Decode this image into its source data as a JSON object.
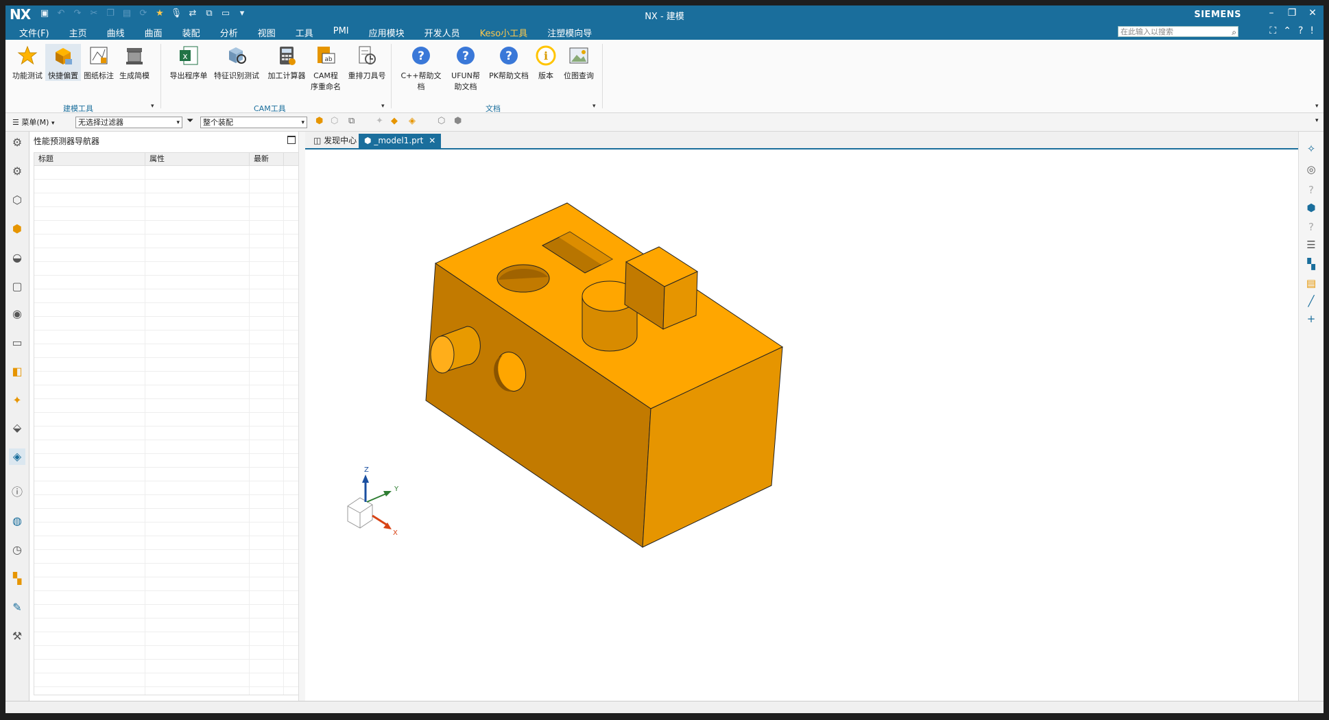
{
  "app": {
    "logo": "NX",
    "title": "NX - 建模",
    "brand": "SIEMENS"
  },
  "menu": {
    "items": [
      "文件(F)",
      "主页",
      "曲线",
      "曲面",
      "装配",
      "分析",
      "视图",
      "工具",
      "PMI",
      "应用模块",
      "开发人员",
      "Keso小工具",
      "注塑模向导"
    ],
    "active": "Keso小工具",
    "search_placeholder": "在此输入以搜索"
  },
  "ribbon": {
    "buttons": [
      {
        "label": "功能测试",
        "icon": "star-icon"
      },
      {
        "label": "快捷偏置",
        "icon": "offset-block-icon"
      },
      {
        "label": "图纸标注",
        "icon": "drawing-annotation-icon"
      },
      {
        "label": "生成简模",
        "icon": "simple-model-icon"
      },
      {
        "label": "导出程序单",
        "icon": "excel-icon"
      },
      {
        "label": "特征识别测试",
        "icon": "feature-recognition-icon"
      },
      {
        "label": "加工计算器",
        "icon": "calculator-icon"
      },
      {
        "label": "CAM程序重命名",
        "icon": "cam-rename-icon"
      },
      {
        "label": "重排刀具号",
        "icon": "tool-renumber-icon"
      },
      {
        "label": "C++帮助文档",
        "icon": "help-icon"
      },
      {
        "label": "UFUN帮助文档",
        "icon": "help-icon"
      },
      {
        "label": "PK帮助文档",
        "icon": "help-icon"
      },
      {
        "label": "版本",
        "icon": "info-icon"
      },
      {
        "label": "位图查询",
        "icon": "image-icon"
      }
    ],
    "groups": [
      "建模工具",
      "CAM工具",
      "文档"
    ]
  },
  "selection": {
    "menu_label": "菜单(M)",
    "filter": "无选择过滤器",
    "scope": "整个装配"
  },
  "navigator": {
    "title": "性能预测器导航器",
    "columns": [
      "标题",
      "属性",
      "最新"
    ]
  },
  "tabs": [
    {
      "label": "发现中心"
    },
    {
      "label": "_model1.prt"
    }
  ],
  "triad": {
    "z": "Z",
    "y": "Y",
    "x": "X"
  },
  "colors": {
    "accent": "#1a6e9c",
    "model_top": "#ffa600",
    "model_left": "#c27a00",
    "model_right": "#e69500"
  }
}
